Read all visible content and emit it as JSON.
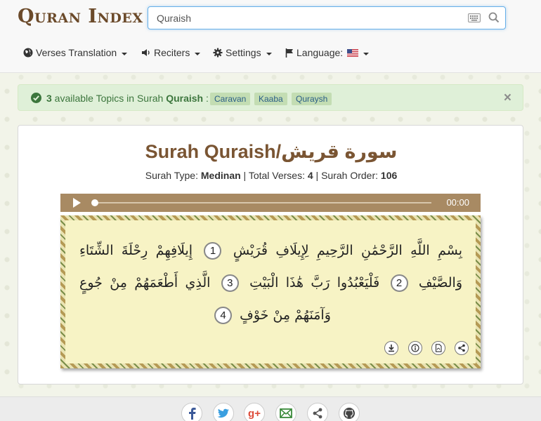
{
  "header": {
    "logo_text": "Quran Index",
    "search": {
      "value": "Quraish",
      "placeholder": ""
    },
    "menu": {
      "verses_translation": "Verses Translation",
      "reciters": "Reciters",
      "settings": "Settings",
      "language": "Language:"
    }
  },
  "alert": {
    "count": "3",
    "text_before": " available Topics in Surah ",
    "surah": "Quraish",
    "separator": " :",
    "topics": [
      "Caravan",
      "Kaaba",
      "Quraysh"
    ],
    "close": "×"
  },
  "surah": {
    "title": "Surah Quraish/سورة قريش",
    "type_label": "Surah Type: ",
    "type_value": "Medinan",
    "verses_label": " | Total Verses: ",
    "verses_value": "4",
    "order_label": " | Surah Order: ",
    "order_value": "106"
  },
  "player": {
    "time": "00:00",
    "progress": 0
  },
  "verses": [
    {
      "number": "1",
      "text": "بِسْمِ اللَّهِ الرَّحْمَٰنِ الرَّحِيمِ لِإِيلَافِ قُرَيْشٍ"
    },
    {
      "number": "2",
      "text": "إِيلَافِهِمْ رِحْلَةَ الشِّتَاءِ وَالصَّيْفِ"
    },
    {
      "number": "3",
      "text": "فَلْيَعْبُدُوا رَبَّ هَٰذَا الْبَيْتِ"
    },
    {
      "number": "4",
      "text": "الَّذِي أَطْعَمَهُمْ مِنْ جُوعٍ وَآمَنَهُمْ مِنْ خَوْفٍ"
    }
  ],
  "colors": {
    "accent": "#66afe9",
    "title_brown": "#7a5533",
    "alert_green": "#3c763d",
    "player_bg": "#a88a63",
    "verse_bg": "#f7f3c5"
  }
}
